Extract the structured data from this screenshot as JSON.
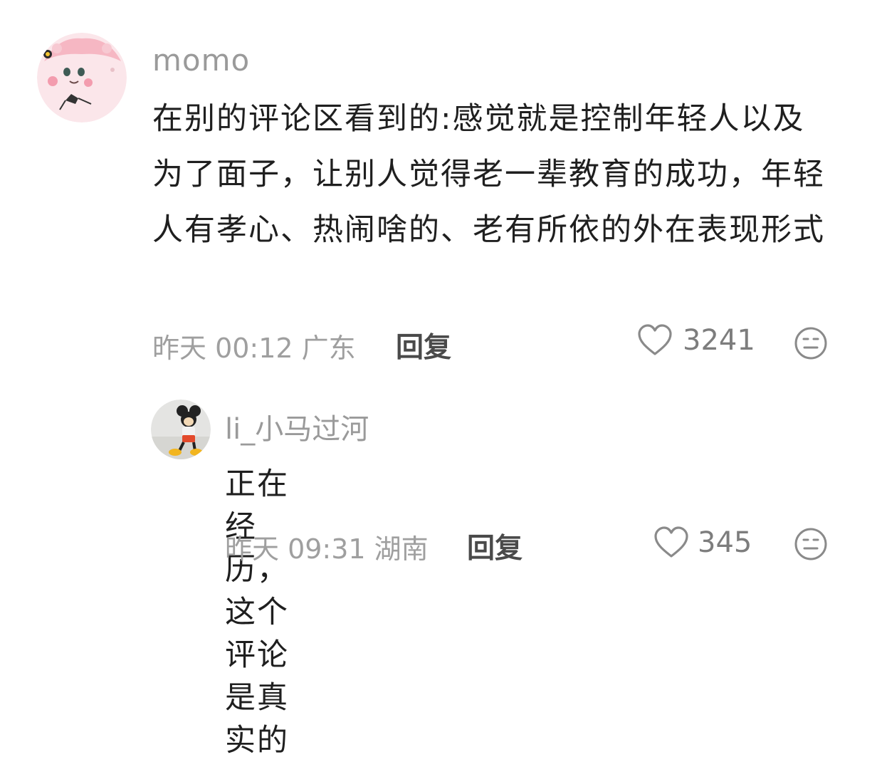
{
  "comments": [
    {
      "username": "momo",
      "text": "在别的评论区看到的:感觉就是控制年轻人以及为了面子，让别人觉得老一辈教育的成功，年轻人有孝心、热闹啥的、老有所依的外在表现形式",
      "meta": "昨天 00:12 广东",
      "reply_label": "回复",
      "like_count": "3241",
      "avatar_icon": "pink-cartoon-avatar",
      "like_icon": "heart-outline-icon",
      "emoji_icon": "neutral-face-icon"
    },
    {
      "username": "li_小马过河",
      "text": "正在经历，这个评论是真实的",
      "meta": "昨天 09:31 湖南",
      "reply_label": "回复",
      "like_count": "345",
      "avatar_icon": "mickey-mouse-avatar",
      "like_icon": "heart-outline-icon",
      "emoji_icon": "neutral-face-icon"
    }
  ],
  "colors": {
    "background": "#ffffff",
    "username": "#9a9a9a",
    "body_text": "#1f1f1f",
    "meta_text": "#9f9f9f",
    "reply_text": "#4a4a4a",
    "icon": "#8a8a8a"
  }
}
